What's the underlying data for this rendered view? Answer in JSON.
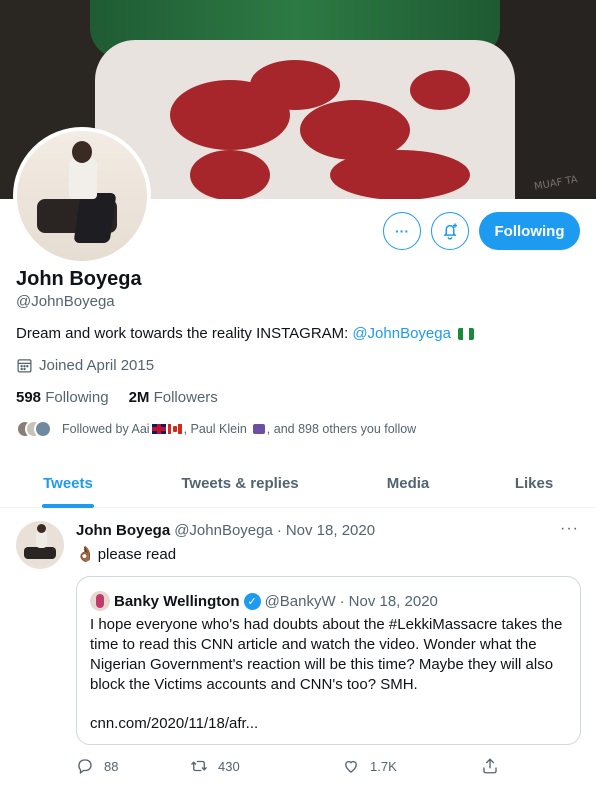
{
  "profile": {
    "name": "John Boyega",
    "handle": "@JohnBoyega",
    "bio_text": "Dream and work towards the reality INSTAGRAM:",
    "bio_link": "@JohnBoyega",
    "joined": "Joined April 2015",
    "following_count": "598",
    "following_label": "Following",
    "followers_count": "2M",
    "followers_label": "Followers",
    "followed_by_prefix": "Followed by Aai",
    "followed_by_middle": ", Paul Klein",
    "followed_by_suffix": ", and 898 others you follow"
  },
  "banner": {
    "tag_text": "MUAF TA"
  },
  "buttons": {
    "more_label": "···",
    "follow_label": "Following"
  },
  "tabs": [
    {
      "label": "Tweets",
      "active": true
    },
    {
      "label": "Tweets & replies",
      "active": false
    },
    {
      "label": "Media",
      "active": false
    },
    {
      "label": "Likes",
      "active": false
    }
  ],
  "tweet": {
    "author": "John Boyega",
    "handle": "@JohnBoyega",
    "separator": "·",
    "date": "Nov 18, 2020",
    "emoji": "👌🏾",
    "text": "please read",
    "more": "···",
    "quote": {
      "author": "Banky Wellington",
      "verified_glyph": "✓",
      "handle": "@BankyW",
      "separator": "·",
      "date": "Nov 18, 2020",
      "text": "I hope everyone who's had doubts about the #LekkiMassacre takes the time to read this CNN article and watch the video. Wonder what the Nigerian Government's reaction will be this time? Maybe they will also block the Victims accounts and CNN's too? SMH.",
      "link": "cnn.com/2020/11/18/afr..."
    },
    "stats": {
      "replies": "88",
      "retweets": "430",
      "likes": "1.7K"
    }
  },
  "colors": {
    "accent": "#1d9bf0",
    "text": "#0f1419",
    "muted": "#536471",
    "border": "#cfd9de"
  },
  "icons": [
    "more-icon",
    "notification-bell-icon",
    "calendar-icon",
    "verified-badge-icon",
    "reply-icon",
    "retweet-icon",
    "like-icon",
    "share-icon",
    "nigeria-flag-icon",
    "uk-flag-icon",
    "canada-flag-icon",
    "alien-emoji-icon",
    "ok-hand-emoji-icon"
  ]
}
